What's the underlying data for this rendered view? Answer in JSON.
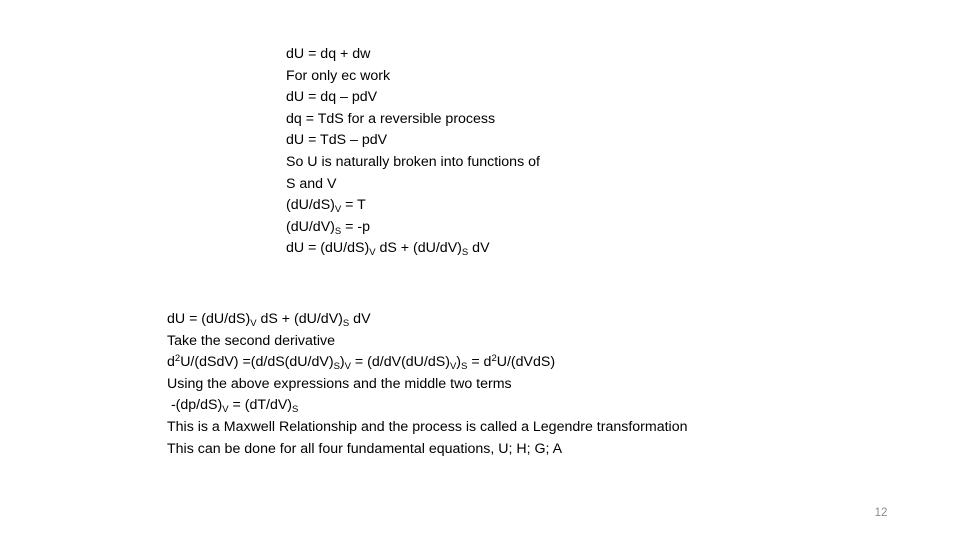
{
  "slide": {
    "number": "12",
    "top_block": {
      "lines": [
        {
          "text": "dU = dq + dw"
        },
        {
          "text": "For only ec work"
        },
        {
          "text": "dU = dq – pdV"
        },
        {
          "text": "dq = TdS for a reversible process"
        },
        {
          "text": "dU = TdS – pdV"
        },
        {
          "text": "So U is naturally broken into functions of"
        },
        {
          "text": "S and V"
        },
        {
          "parts": [
            "(dU/dS)",
            "V",
            " = T"
          ]
        },
        {
          "parts": [
            "(dU/dV)",
            "S",
            " = -p"
          ]
        },
        {
          "parts": [
            "dU = (dU/dS)",
            "V",
            " dS + (dU/dV)",
            "S",
            " dV"
          ]
        }
      ]
    },
    "bottom_block": {
      "lines": [
        {
          "parts": [
            "dU = (dU/dS)",
            "V",
            " dS + (dU/dV)",
            "S",
            " dV"
          ]
        },
        {
          "text": "Take the second derivative"
        },
        {
          "parts": [
            "d",
            "2",
            "U/(dSdV) =(d/dS(dU/dV)",
            "S",
            ")",
            "V",
            " = (d/dV(dU/dS)",
            "V",
            ")",
            "S",
            " = d",
            "2",
            "U/(dVdS)"
          ]
        },
        {
          "text": "Using the above expressions and the middle two terms"
        },
        {
          "parts": [
            " -(dp/dS)",
            "V",
            " = (dT/dV)",
            "S"
          ]
        },
        {
          "text": "This is a Maxwell Relationship and the process is called a Legendre transformation"
        },
        {
          "text": "This can be done for all four fundamental equations, U; H; G; A"
        }
      ]
    }
  }
}
